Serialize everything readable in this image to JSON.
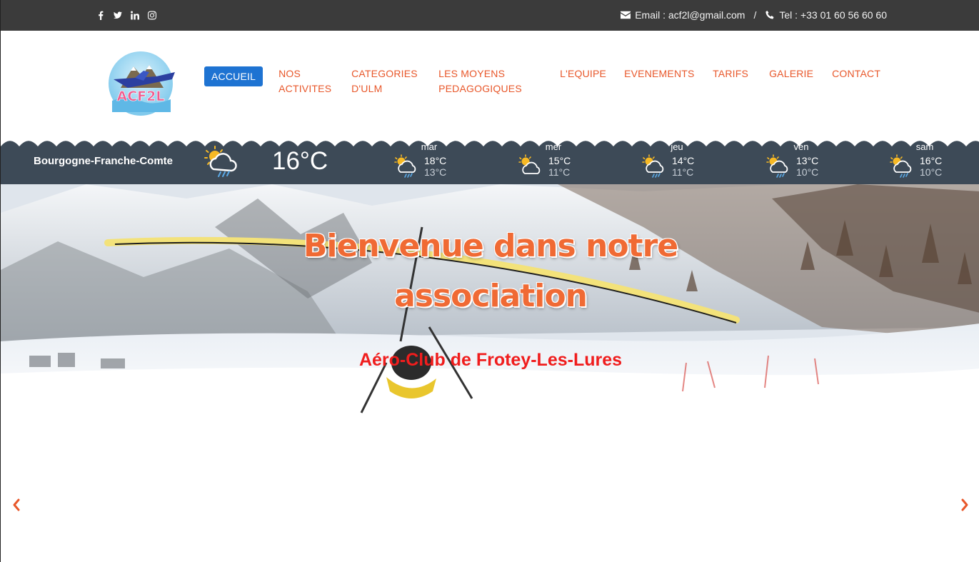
{
  "topbar": {
    "social_icons": [
      "facebook-icon",
      "twitter-icon",
      "linkedin-icon",
      "instagram-icon"
    ],
    "email": "Email : acf2l@gmail.com",
    "separator": "/",
    "phone": "Tel : +33 01 60 56 60 60"
  },
  "logo": {
    "text": "ACF2L"
  },
  "nav": {
    "items": [
      {
        "label": "ACCUEIL",
        "active": true
      },
      {
        "label": "NOS\nACTIVITES"
      },
      {
        "label": "CATEGORIES\nD'ULM"
      },
      {
        "label": "LES MOYENS\nPEDAGOGIQUES"
      },
      {
        "label": "L'EQUIPE"
      },
      {
        "label": "EVENEMENTS"
      },
      {
        "label": "TARIFS"
      },
      {
        "label": "GALERIE"
      },
      {
        "label": "CONTACT"
      }
    ]
  },
  "weather": {
    "region": "Bourgogne-Franche-Comte",
    "current_temp": "16°C",
    "current_icon": "sun-cloud-rain-icon",
    "days": [
      {
        "name": "mar",
        "hi": "18°C",
        "lo": "13°C",
        "icon": "sun-cloud-rain-icon"
      },
      {
        "name": "mer",
        "hi": "15°C",
        "lo": "11°C",
        "icon": "sun-cloud-icon"
      },
      {
        "name": "jeu",
        "hi": "14°C",
        "lo": "11°C",
        "icon": "sun-cloud-rain-icon"
      },
      {
        "name": "ven",
        "hi": "13°C",
        "lo": "10°C",
        "icon": "sun-cloud-rain-icon"
      },
      {
        "name": "sam",
        "hi": "16°C",
        "lo": "10°C",
        "icon": "sun-cloud-rain-icon"
      }
    ]
  },
  "hero": {
    "title": "Bienvenue dans notre association",
    "subtitle": "Aéro-Club de Frotey-Les-Lures"
  },
  "colors": {
    "topbar": "#3b3b3b",
    "nav_text": "#e8572a",
    "nav_active": "#1e73d2",
    "weather_bg": "#3d4a57",
    "hero_title": "#f06a34",
    "hero_subtitle": "#f01d1d"
  }
}
